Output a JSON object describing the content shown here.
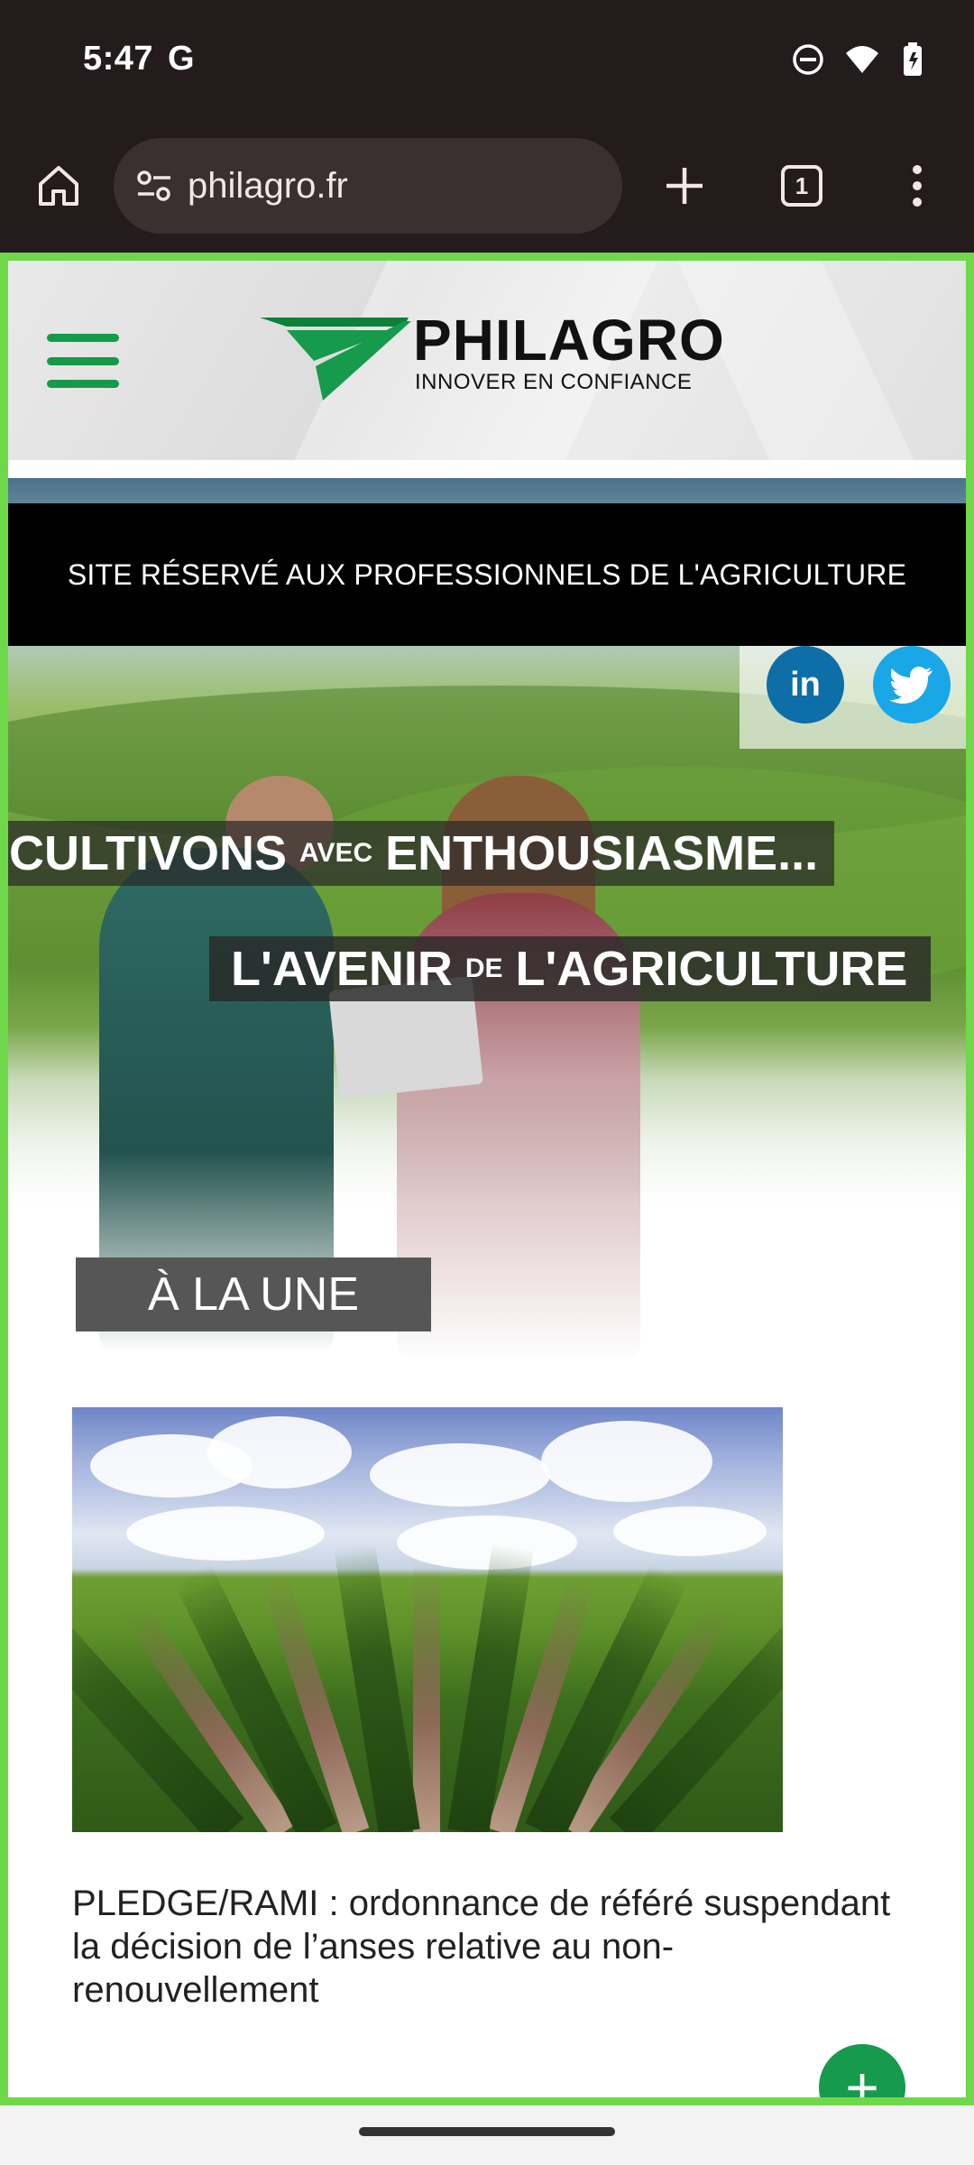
{
  "status": {
    "time": "5:47",
    "google_glyph": "G",
    "icons": [
      "dnd-icon",
      "wifi-icon",
      "battery-icon"
    ]
  },
  "browser": {
    "url": "philagro.fr",
    "tab_count": "1"
  },
  "site": {
    "logo_name": "PHILAGRO",
    "logo_tagline": "INNOVER EN CONFIANCE",
    "pro_banner": "SITE RÉSERVÉ AUX PROFESSIONNELS DE L'AGRICULTURE",
    "social": {
      "linkedin": "in"
    },
    "tagline1": {
      "part1": "CULTIVONS",
      "small": "AVEC",
      "part2": "ENTHOUSIASME..."
    },
    "tagline2": {
      "part1": "L'AVENIR",
      "small": "DE",
      "part2": "L'AGRICULTURE"
    },
    "section_title": "À LA UNE",
    "article_title": "PLEDGE/RAMI : ordonnance de référé suspendant la décision de l’anses relative au non-renouvellement",
    "fab_label": "+"
  },
  "colors": {
    "brand_green": "#169a4c",
    "highlight_frame": "#6fd84a",
    "browser_chrome": "#241b1d",
    "linkedin": "#0e6ea8",
    "twitter": "#19a7e8"
  }
}
